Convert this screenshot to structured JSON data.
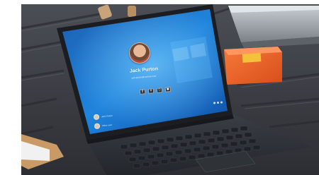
{
  "image": {
    "caption_free": true,
    "description_hint": "Laptop with blue Windows lock/sign-in screen on a dark ribbed surface"
  },
  "screen": {
    "user_name": "Jack Purton",
    "user_email": "jack.purton@contoso.com",
    "signin_buttons": [
      {
        "icon": "key-icon",
        "label": "⚷"
      },
      {
        "icon": "pin-icon",
        "label": "#"
      },
      {
        "icon": "face-icon",
        "label": "☺"
      },
      {
        "icon": "fingerprint-icon",
        "label": "◉"
      }
    ],
    "corner_users": [
      {
        "name": "Jack Purton"
      },
      {
        "name": "Other user"
      }
    ]
  },
  "colors": {
    "screen_blue": "#1f7fd6",
    "keyboard": "#2b2f35",
    "background": "#3c3f45",
    "orange_box": "#f0642a"
  }
}
